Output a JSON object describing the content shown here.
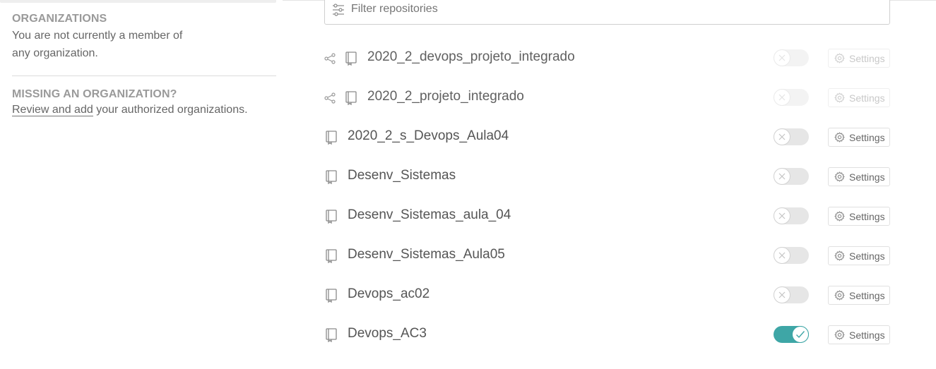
{
  "sidebar": {
    "organizations_heading": "ORGANIZATIONS",
    "organizations_text": "You are not currently a member of any organization.",
    "missing_heading": "MISSING AN ORGANIZATION?",
    "review_link": "Review and add",
    "review_rest": " your authorized organizations."
  },
  "filter": {
    "placeholder": "Filter repositories"
  },
  "settings_label": "Settings",
  "colors": {
    "accent": "#3ea6a6",
    "toggle_off": "#e6e6e6"
  },
  "repos": [
    {
      "name": "2020_2_devops_projeto_integrado",
      "shared": true,
      "enabled": false,
      "disabled_row": true
    },
    {
      "name": "2020_2_projeto_integrado",
      "shared": true,
      "enabled": false,
      "disabled_row": true
    },
    {
      "name": "2020_2_s_Devops_Aula04",
      "shared": false,
      "enabled": false,
      "disabled_row": false
    },
    {
      "name": "Desenv_Sistemas",
      "shared": false,
      "enabled": false,
      "disabled_row": false
    },
    {
      "name": "Desenv_Sistemas_aula_04",
      "shared": false,
      "enabled": false,
      "disabled_row": false
    },
    {
      "name": "Desenv_Sistemas_Aula05",
      "shared": false,
      "enabled": false,
      "disabled_row": false
    },
    {
      "name": "Devops_ac02",
      "shared": false,
      "enabled": false,
      "disabled_row": false
    },
    {
      "name": "Devops_AC3",
      "shared": false,
      "enabled": true,
      "disabled_row": false
    }
  ]
}
